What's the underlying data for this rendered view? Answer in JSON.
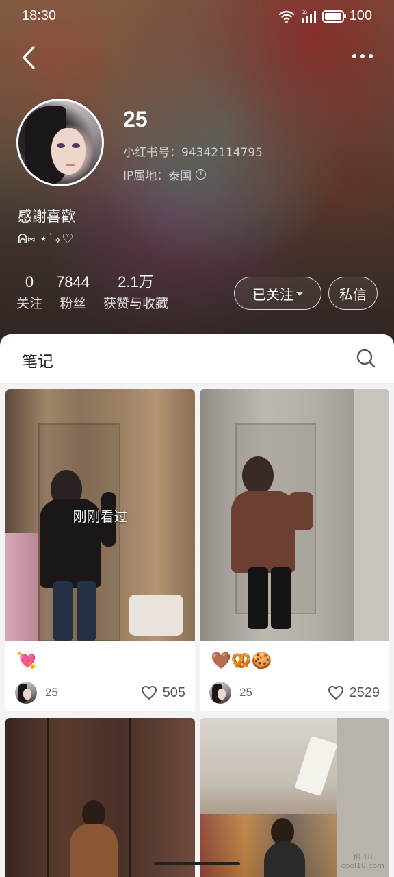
{
  "status_bar": {
    "time": "18:30",
    "network": "5G",
    "battery": "100"
  },
  "profile": {
    "name": "25",
    "id_label": "小红书号：94342114795",
    "ip_label": "IP属地：泰国",
    "bio_title": "感謝喜歡",
    "bio_sub": "ᕱ⑅︎ ⋆˙⟡♡"
  },
  "stats": [
    {
      "value": "0",
      "label": "关注"
    },
    {
      "value": "7844",
      "label": "粉丝"
    },
    {
      "value": "2.1万",
      "label": "获赞与收藏"
    }
  ],
  "actions": {
    "follow_label": "已关注",
    "message_label": "私信"
  },
  "tabs": {
    "notes_label": "笔记"
  },
  "notes": [
    {
      "seen_label": "刚刚看过",
      "title": "💘",
      "author": "25",
      "likes": "505"
    },
    {
      "title": "🤎🥨🍪",
      "author": "25",
      "likes": "2529"
    }
  ],
  "watermark": "锦 18\ncool18.com",
  "colors": {
    "accent_text": "#222222",
    "secondary_text": "#666666",
    "feed_background": "#f3f3f3"
  },
  "icons": [
    "back-arrow-icon",
    "more-icon",
    "wifi-icon",
    "signal-icon",
    "battery-icon",
    "info-icon",
    "caret-down-icon",
    "search-icon",
    "heart-icon"
  ]
}
